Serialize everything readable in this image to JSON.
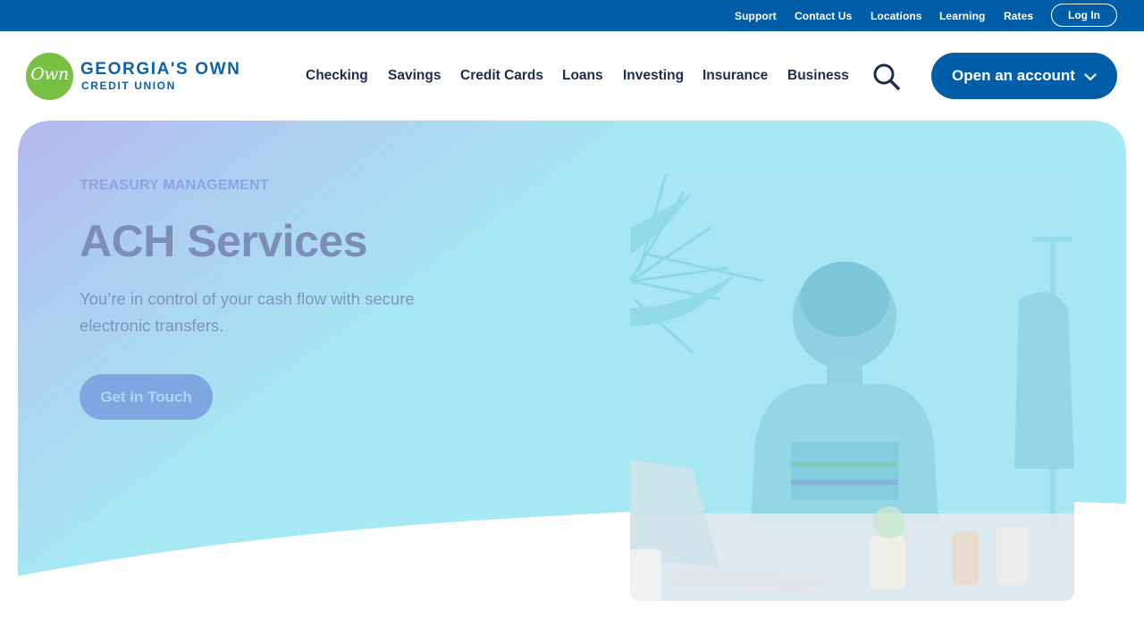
{
  "utility": {
    "links": [
      "Support",
      "Contact Us",
      "Locations",
      "Learning",
      "Rates"
    ],
    "login_label": "Log In"
  },
  "brand": {
    "mark": "Own",
    "name_line1": "GEORGIA'S OWN",
    "name_line2": "CREDIT UNION"
  },
  "nav": {
    "items": [
      "Checking",
      "Savings",
      "Credit Cards",
      "Loans",
      "Investing",
      "Insurance",
      "Business"
    ],
    "search_icon": "search-icon",
    "open_account_label": "Open an account",
    "open_account_icon": "chevron-down-icon"
  },
  "hero": {
    "eyebrow": "TREASURY MANAGEMENT",
    "title": "ACH Services",
    "description": "You’re in control of your cash flow with secure electronic transfers.",
    "cta_label": "Get in Touch"
  },
  "colors": {
    "utility_bar": "#005ea8",
    "primary": "#005ea8",
    "logo_green": "#78c043",
    "gradient_start": "#b4b8ee",
    "gradient_end": "#a6e8f3"
  }
}
